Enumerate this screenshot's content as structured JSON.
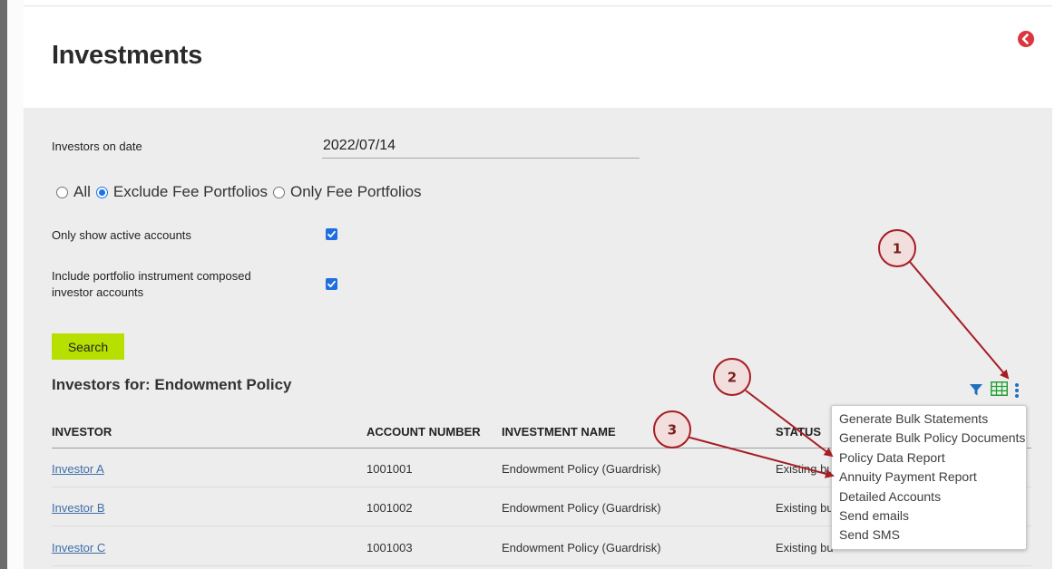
{
  "page": {
    "title": "Investments"
  },
  "filters": {
    "date_label": "Investors on date",
    "date_value": "2022/07/14",
    "radios": [
      {
        "label": "All",
        "checked": false
      },
      {
        "label": "Exclude Fee Portfolios",
        "checked": true
      },
      {
        "label": "Only Fee Portfolios",
        "checked": false
      }
    ],
    "active_label": "Only show active accounts",
    "active_checked": true,
    "composed_label_line1": "Include portfolio instrument composed",
    "composed_label_line2": "investor accounts",
    "composed_checked": true,
    "search_label": "Search"
  },
  "results": {
    "title": "Investors for: Endowment Policy",
    "columns": [
      "INVESTOR",
      "ACCOUNT NUMBER",
      "INVESTMENT NAME",
      "STATUS"
    ],
    "rows": [
      {
        "investor": "Investor A",
        "account": "1001001",
        "name": "Endowment Policy (Guardrisk)",
        "status": "Existing bu"
      },
      {
        "investor": "Investor B",
        "account": "1001002",
        "name": "Endowment Policy (Guardrisk)",
        "status": "Existing bu"
      },
      {
        "investor": "Investor C",
        "account": "1001003",
        "name": "Endowment Policy (Guardrisk)",
        "status": "Existing bu"
      }
    ]
  },
  "menu": {
    "items": [
      "Generate Bulk Statements",
      "Generate Bulk Policy Documents",
      "Policy Data Report",
      "Annuity Payment Report",
      "Detailed Accounts",
      "Send emails",
      "Send SMS"
    ]
  },
  "annotations": {
    "badges": [
      "1",
      "2",
      "3"
    ]
  },
  "icons": {
    "back": "chevron-left-circle-icon",
    "filter": "filter-icon",
    "grid": "table-grid-icon",
    "more": "vertical-ellipsis-icon"
  },
  "colors": {
    "accent_button": "#b7e000",
    "link": "#3f6ea8",
    "icon_blue": "#1f6fbf",
    "icon_green": "#2e9d3e",
    "back_red": "#d9363e",
    "annotation": "#a61d24"
  }
}
